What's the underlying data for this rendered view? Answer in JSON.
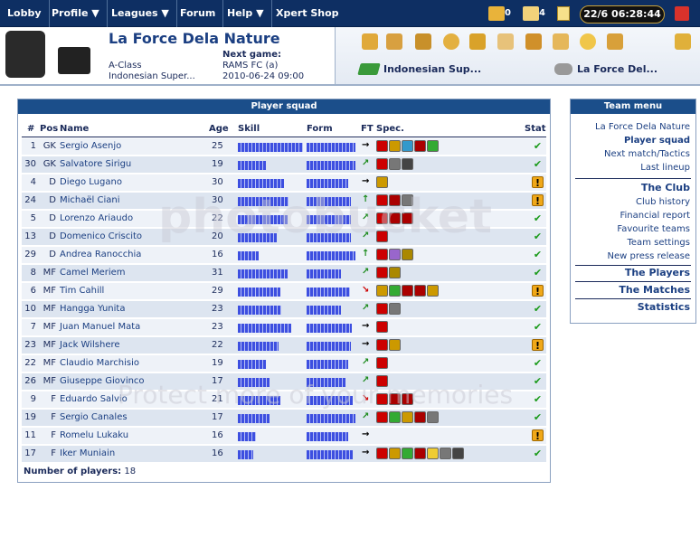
{
  "nav": {
    "lobby": "Lobby",
    "profile": "Profile ▼",
    "leagues": "Leagues ▼",
    "forum": "Forum",
    "help": "Help ▼",
    "shop": "Xpert Shop"
  },
  "topstats": {
    "mail_count": "0",
    "notes_count": "4",
    "clock": "22/6 06:28:44"
  },
  "club": {
    "name": "La Force Dela Nature",
    "class": "A-Class",
    "league": "Indonesian Super...",
    "next_game_label": "Next game:",
    "next_game_opponent": "RAMS FC (a)",
    "next_game_time": "2010-06-24 09:00"
  },
  "selectors": {
    "league": "Indonesian Sup...",
    "team": "La Force Del..."
  },
  "squad": {
    "title": "Player squad",
    "headers": {
      "num": "#",
      "pos": "Pos",
      "name": "Name",
      "age": "Age",
      "skill": "Skill",
      "form": "Form",
      "ft": "FT",
      "spec": "Spec.",
      "stat": "Stat"
    },
    "players": [
      {
        "num": "1",
        "pos": "GK",
        "name": "Sergio Asenjo",
        "age": "25",
        "skill": 0.92,
        "form": 1.0,
        "ft": "→",
        "spec": [
          "#c00",
          "#c90",
          "#39c",
          "#a00",
          "#3a3"
        ],
        "stat": "ok"
      },
      {
        "num": "30",
        "pos": "GK",
        "name": "Salvatore Sirigu",
        "age": "19",
        "skill": 0.4,
        "form": 1.0,
        "ft": "↗",
        "spec": [
          "#c00",
          "#777",
          "#444"
        ],
        "stat": "ok"
      },
      {
        "num": "4",
        "pos": "D",
        "name": "Diego Lugano",
        "age": "30",
        "skill": 0.65,
        "form": 0.85,
        "ft": "→",
        "spec": [
          "#c90"
        ],
        "stat": "warn"
      },
      {
        "num": "24",
        "pos": "D",
        "name": "Michaël Ciani",
        "age": "30",
        "skill": 0.72,
        "form": 0.9,
        "ft": "↑",
        "spec": [
          "#c00",
          "#a00",
          "#777"
        ],
        "stat": "warn"
      },
      {
        "num": "5",
        "pos": "D",
        "name": "Lorenzo Ariaudo",
        "age": "22",
        "skill": 0.7,
        "form": 0.9,
        "ft": "↗",
        "spec": [
          "#c00",
          "#a00",
          "#a00"
        ],
        "stat": "ok"
      },
      {
        "num": "13",
        "pos": "D",
        "name": "Domenico Criscito",
        "age": "20",
        "skill": 0.55,
        "form": 0.9,
        "ft": "↗",
        "spec": [
          "#c00"
        ],
        "stat": "ok"
      },
      {
        "num": "29",
        "pos": "D",
        "name": "Andrea Ranocchia",
        "age": "16",
        "skill": 0.3,
        "form": 1.0,
        "ft": "↑",
        "spec": [
          "#c00",
          "#96c",
          "#a80"
        ],
        "stat": "ok"
      },
      {
        "num": "8",
        "pos": "MF",
        "name": "Camel Meriem",
        "age": "31",
        "skill": 0.7,
        "form": 0.7,
        "ft": "↗",
        "spec": [
          "#c00",
          "#a80"
        ],
        "stat": "ok"
      },
      {
        "num": "6",
        "pos": "MF",
        "name": "Tim Cahill",
        "age": "29",
        "skill": 0.6,
        "form": 0.88,
        "ft": "↘",
        "spec": [
          "#c90",
          "#3a3",
          "#a00",
          "#a00",
          "#c90"
        ],
        "stat": "warn"
      },
      {
        "num": "10",
        "pos": "MF",
        "name": "Hangga Yunita",
        "age": "23",
        "skill": 0.62,
        "form": 0.7,
        "ft": "↗",
        "spec": [
          "#c00",
          "#777"
        ],
        "stat": "ok"
      },
      {
        "num": "7",
        "pos": "MF",
        "name": "Juan Manuel Mata",
        "age": "23",
        "skill": 0.75,
        "form": 0.92,
        "ft": "→",
        "spec": [
          "#c00"
        ],
        "stat": "ok"
      },
      {
        "num": "23",
        "pos": "MF",
        "name": "Jack Wilshere",
        "age": "22",
        "skill": 0.58,
        "form": 0.9,
        "ft": "→",
        "spec": [
          "#c00",
          "#c90"
        ],
        "stat": "warn"
      },
      {
        "num": "22",
        "pos": "MF",
        "name": "Claudio Marchisio",
        "age": "19",
        "skill": 0.4,
        "form": 0.85,
        "ft": "↗",
        "spec": [
          "#c00"
        ],
        "stat": "ok"
      },
      {
        "num": "26",
        "pos": "MF",
        "name": "Giuseppe Giovinco",
        "age": "17",
        "skill": 0.45,
        "form": 0.8,
        "ft": "↗",
        "spec": [
          "#c00"
        ],
        "stat": "ok"
      },
      {
        "num": "9",
        "pos": "F",
        "name": "Eduardo Salvio",
        "age": "21",
        "skill": 0.6,
        "form": 0.95,
        "ft": "↘",
        "spec": [
          "#c00",
          "#a00",
          "#a00"
        ],
        "stat": "ok"
      },
      {
        "num": "19",
        "pos": "F",
        "name": "Sergio Canales",
        "age": "17",
        "skill": 0.45,
        "form": 1.0,
        "ft": "↗",
        "spec": [
          "#c00",
          "#3a3",
          "#c90",
          "#a00",
          "#777"
        ],
        "stat": "ok"
      },
      {
        "num": "11",
        "pos": "F",
        "name": "Romelu Lukaku",
        "age": "16",
        "skill": 0.25,
        "form": 0.85,
        "ft": "→",
        "spec": [],
        "stat": "warn"
      },
      {
        "num": "17",
        "pos": "F",
        "name": "Iker Muniain",
        "age": "16",
        "skill": 0.22,
        "form": 0.95,
        "ft": "→",
        "spec": [
          "#c00",
          "#c90",
          "#3a3",
          "#a00",
          "#ec3",
          "#777",
          "#444"
        ],
        "stat": "ok"
      }
    ],
    "count_label": "Number of players:",
    "count_value": "18"
  },
  "menu": {
    "title": "Team menu",
    "items": [
      {
        "label": "La Force Dela Nature",
        "bold": false
      },
      {
        "label": "Player squad",
        "bold": true
      },
      {
        "label": "Next match/Tactics",
        "bold": false
      },
      {
        "label": "Last lineup",
        "bold": false
      }
    ],
    "club_section": "The Club",
    "club_items": [
      "Club history",
      "Financial report",
      "Favourite teams",
      "Team settings",
      "New press release"
    ],
    "players_section": "The Players",
    "matches_section": "The Matches",
    "statistics_section": "Statistics"
  },
  "watermark": {
    "main": "photobucket",
    "sub": "Protect more of your memories"
  }
}
